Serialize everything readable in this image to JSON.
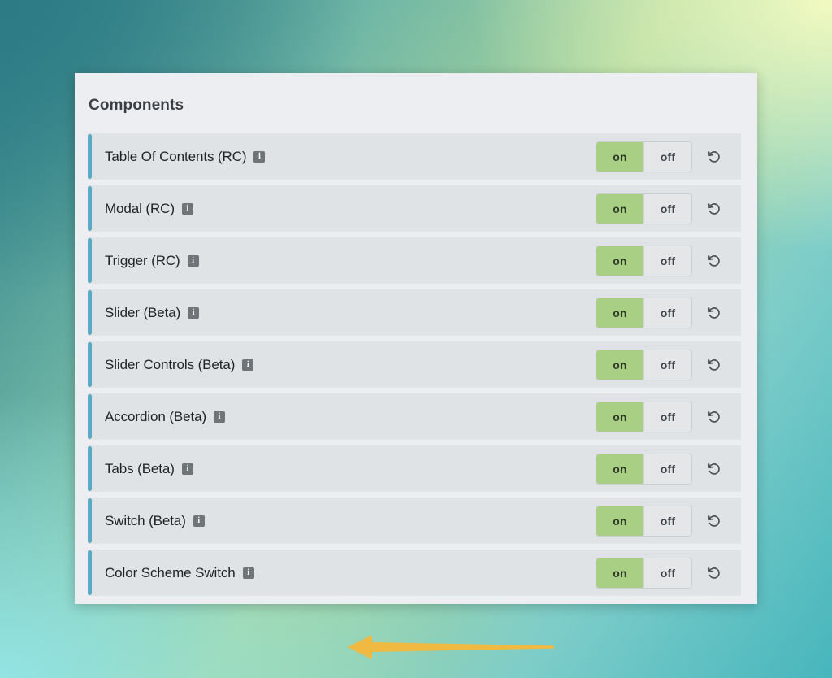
{
  "panel": {
    "title": "Components"
  },
  "toggle": {
    "on_label": "on",
    "off_label": "off",
    "reset_icon": "reset-undo-icon",
    "on_color": "#a9cf85",
    "off_color": "#e4e6e8"
  },
  "icons": {
    "info": "i",
    "info_name": "info-icon"
  },
  "annotation": {
    "arrow_name": "pointer-arrow-annotation",
    "arrow_color": "#f0b942",
    "points_to": "Color Scheme Switch"
  },
  "colors": {
    "panel_background": "#edeef1",
    "row_background": "#dfe3e5",
    "row_accent": "#5aa8c4",
    "label_text": "#1f2328",
    "title_text": "#3a4046"
  },
  "rows": [
    {
      "label": "Table Of Contents (RC)",
      "state": "on"
    },
    {
      "label": "Modal (RC)",
      "state": "on"
    },
    {
      "label": "Trigger (RC)",
      "state": "on"
    },
    {
      "label": "Slider (Beta)",
      "state": "on"
    },
    {
      "label": "Slider Controls (Beta)",
      "state": "on"
    },
    {
      "label": "Accordion (Beta)",
      "state": "on"
    },
    {
      "label": "Tabs (Beta)",
      "state": "on"
    },
    {
      "label": "Switch (Beta)",
      "state": "on"
    },
    {
      "label": "Color Scheme Switch",
      "state": "on"
    }
  ]
}
